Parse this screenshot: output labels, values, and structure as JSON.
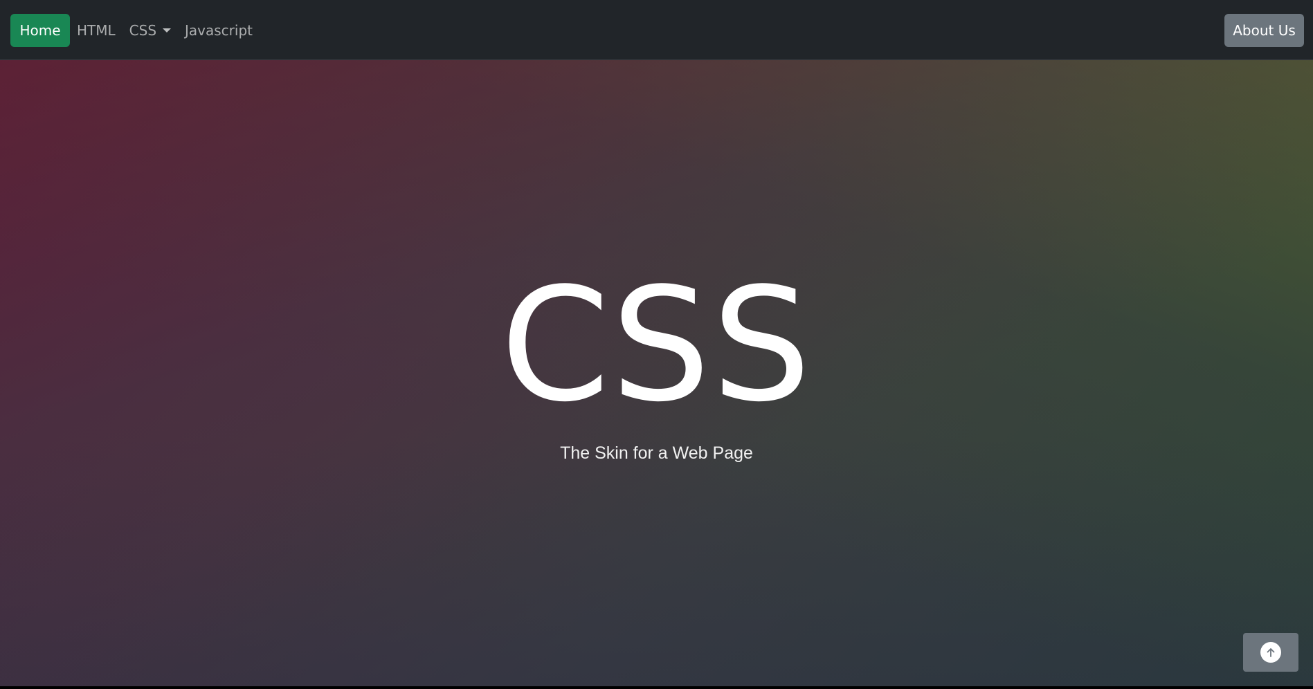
{
  "navbar": {
    "home_label": "Home",
    "links": [
      {
        "label": "HTML"
      },
      {
        "label": "CSS"
      },
      {
        "label": "Javascript"
      }
    ],
    "about_label": "About Us"
  },
  "hero": {
    "title": "CSS",
    "subtitle": "The Skin for a Web Page"
  },
  "colors": {
    "navbar_bg": "#212529",
    "home_button": "#198754",
    "secondary_button": "#6c757d"
  },
  "icons": {
    "dropdown": "caret-down-icon",
    "scroll_top": "arrow-up-circle-icon"
  }
}
